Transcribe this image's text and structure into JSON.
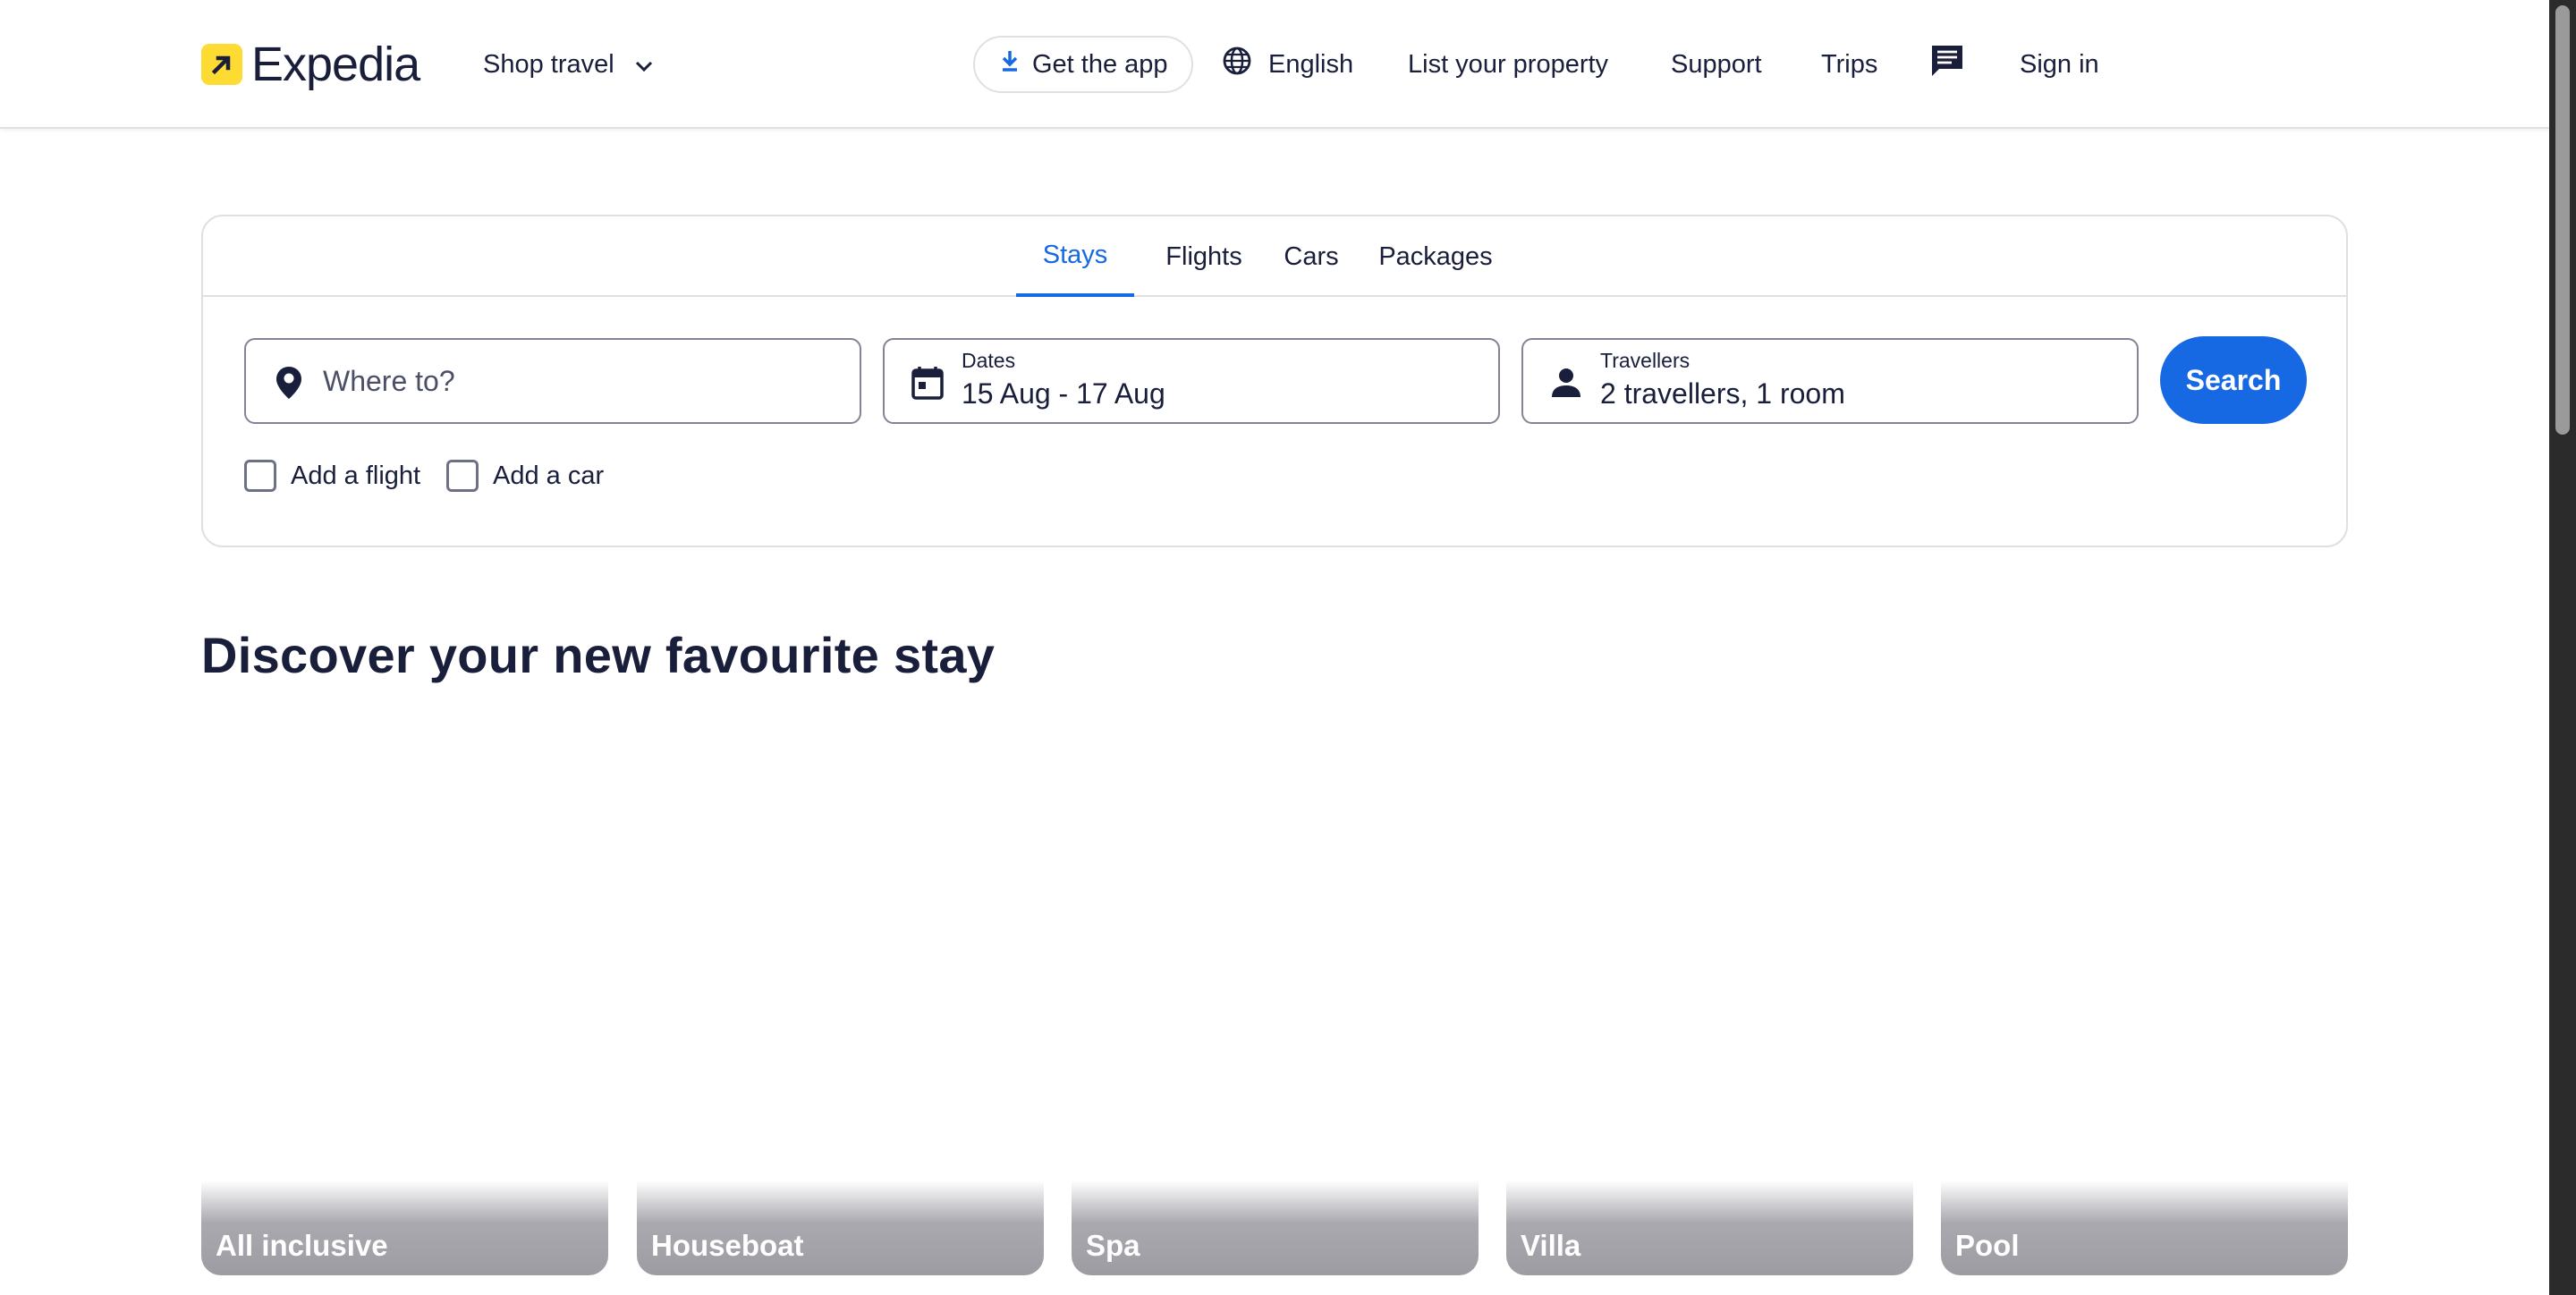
{
  "header": {
    "brand": "Expedia",
    "shop_travel": "Shop travel",
    "get_app": "Get the app",
    "language": "English",
    "list_property": "List your property",
    "support": "Support",
    "trips": "Trips",
    "sign_in": "Sign in"
  },
  "search": {
    "tabs": [
      {
        "label": "Stays",
        "active": true
      },
      {
        "label": "Flights",
        "active": false
      },
      {
        "label": "Cars",
        "active": false
      },
      {
        "label": "Packages",
        "active": false
      }
    ],
    "destination": {
      "placeholder": "Where to?",
      "value": ""
    },
    "dates": {
      "label": "Dates",
      "value": "15 Aug - 17 Aug"
    },
    "travellers": {
      "label": "Travellers",
      "value": "2 travellers, 1 room"
    },
    "search_button": "Search",
    "add_flight": {
      "label": "Add a flight",
      "checked": false
    },
    "add_car": {
      "label": "Add a car",
      "checked": false
    }
  },
  "discover": {
    "title": "Discover your new favourite stay",
    "categories": [
      "All inclusive",
      "Houseboat",
      "Spa",
      "Villa",
      "Pool"
    ]
  },
  "colors": {
    "accent": "#1668e3",
    "text": "#191e3b",
    "logo_yellow": "#fddb32",
    "border": "#dfe0e4"
  },
  "icons": {
    "logo": "expedia-arrow-icon",
    "shop_travel": "chevron-down-icon",
    "get_app": "download-icon",
    "language": "globe-icon",
    "chat": "chat-bubble-icon",
    "destination": "map-pin-icon",
    "dates": "calendar-icon",
    "travellers": "person-icon"
  }
}
